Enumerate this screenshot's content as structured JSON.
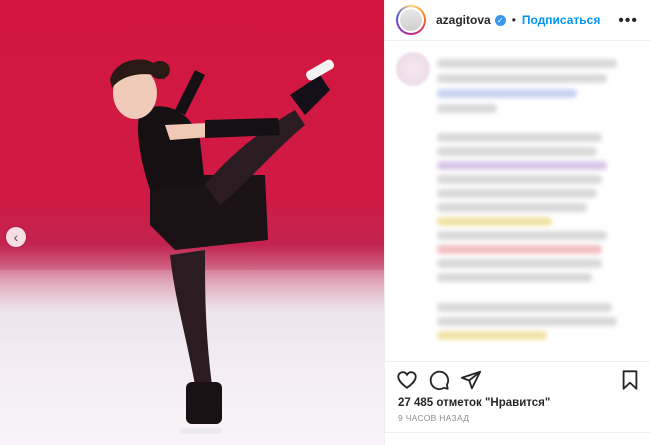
{
  "post": {
    "username": "azagitova",
    "verified": true,
    "separator": "•",
    "follow_label": "Подписаться",
    "more_label": "•••"
  },
  "actions": {
    "like_icon": "heart-icon",
    "comment_icon": "comment-icon",
    "share_icon": "paper-plane-icon",
    "save_icon": "bookmark-icon"
  },
  "stats": {
    "likes_text": "27 485 отметок \"Нравится\"",
    "time_text": "9 ЧАСОВ НАЗАД"
  },
  "carousel": {
    "prev_label": "‹"
  },
  "colors": {
    "accent": "#0095f6",
    "text": "#262626",
    "muted": "#8e8e8e",
    "verified": "#3897f0"
  }
}
